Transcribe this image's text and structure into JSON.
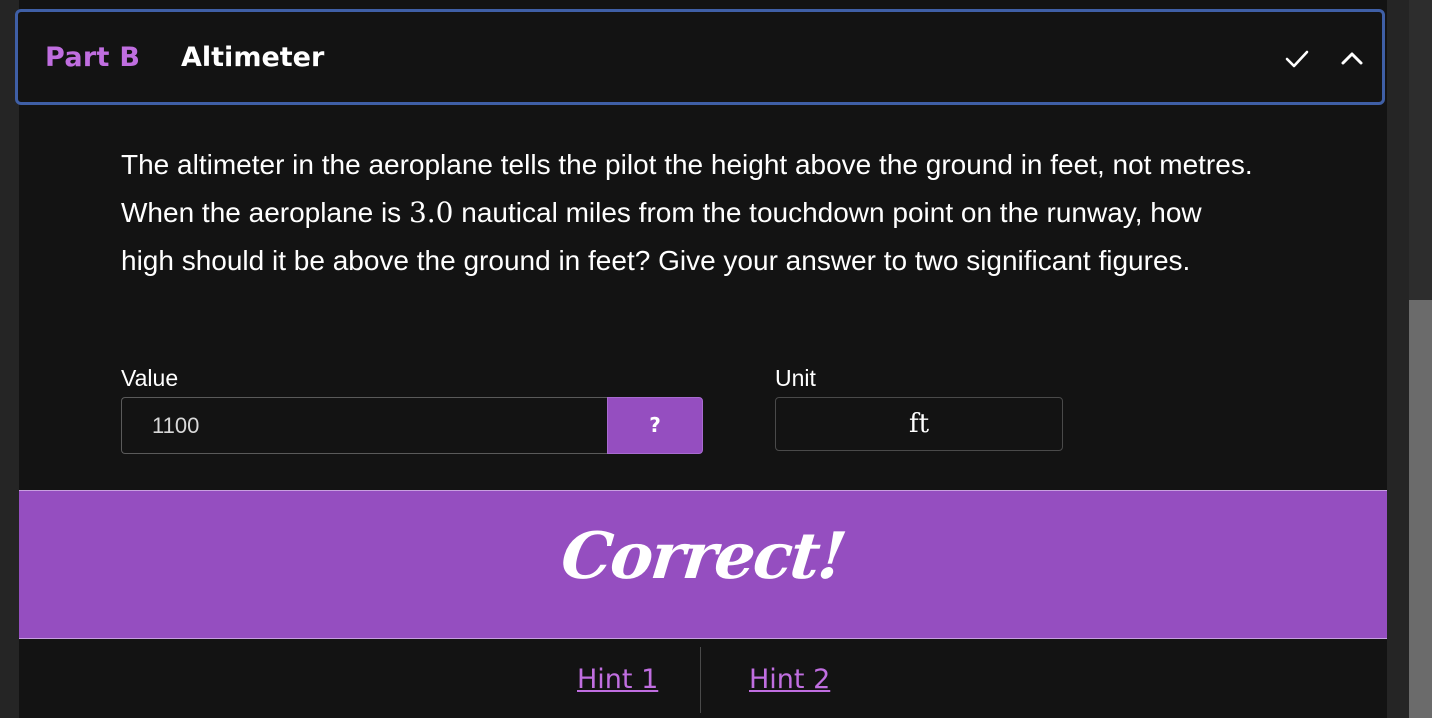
{
  "part": {
    "label": "Part B",
    "title": "Altimeter"
  },
  "icons": {
    "check": "check-icon",
    "collapse": "chevron-up-icon"
  },
  "question": {
    "text_before": "The altimeter in the aeroplane tells the pilot the height above the ground in feet, not metres. When the aeroplane is ",
    "math_value": "3.0",
    "text_after": " nautical miles from the touchdown point on the runway, how high should it be above the ground in feet? Give your answer to two significant figures."
  },
  "answer": {
    "value_label": "Value",
    "value": "1100",
    "help_button": "?",
    "unit_label": "Unit",
    "unit": "ft"
  },
  "feedback": {
    "message": "Correct!"
  },
  "hints": [
    {
      "label": "Hint 1"
    },
    {
      "label": "Hint 2"
    }
  ],
  "colors": {
    "accent": "#954ec0",
    "accent_text": "#c06ee0",
    "header_border": "#3f5fa6",
    "background": "#131313"
  }
}
